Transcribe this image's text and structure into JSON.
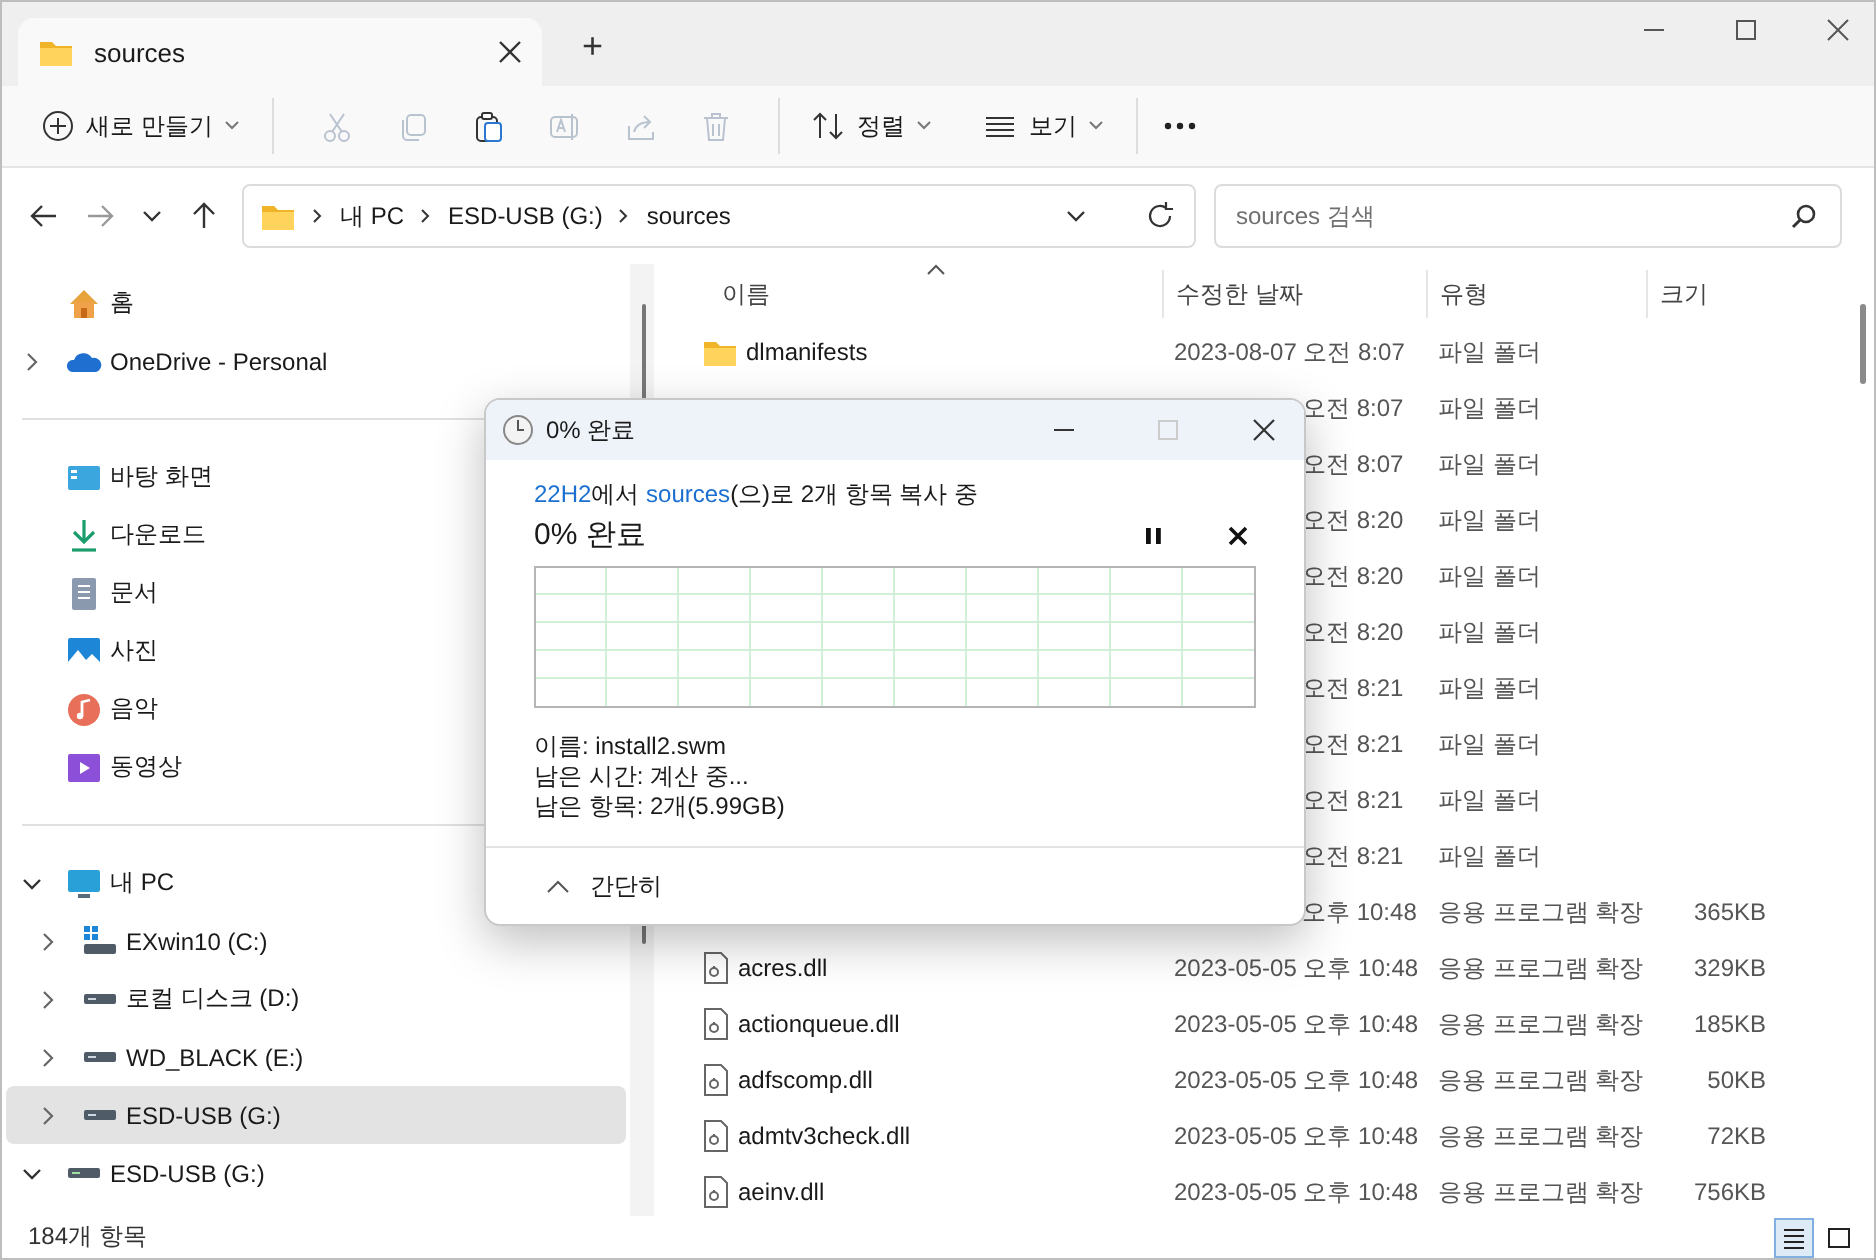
{
  "window": {
    "tab_title": "sources",
    "new_tab": "+"
  },
  "toolbar": {
    "new_label": "새로 만들기",
    "actions": [
      {
        "disabled": true
      },
      {
        "disabled": true
      },
      {
        "disabled": false
      },
      {
        "disabled": true
      },
      {
        "disabled": true
      },
      {
        "disabled": true
      }
    ],
    "sort_label": "정렬",
    "view_label": "보기"
  },
  "address": {
    "crumbs": [
      "내 PC",
      "ESD-USB (G:)",
      "sources"
    ],
    "search": {
      "placeholder": "sources 검색"
    }
  },
  "sidebar": {
    "sections": [
      [
        {
          "label": "홈",
          "selected": false
        },
        {
          "label": "OneDrive - Personal",
          "selected": false,
          "expanded": false
        }
      ],
      [
        {
          "label": "바탕 화면",
          "selected": false
        },
        {
          "label": "다운로드",
          "selected": false
        },
        {
          "label": "문서",
          "selected": false
        },
        {
          "label": "사진",
          "selected": false
        },
        {
          "label": "음악",
          "selected": false
        },
        {
          "label": "동영상",
          "selected": false
        }
      ],
      [
        {
          "label": "내 PC",
          "selected": false,
          "expanded": true,
          "children": [
            {
              "label": "EXwin10 (C:)",
              "selected": false,
              "expanded": false
            },
            {
              "label": "로컬 디스크 (D:)",
              "selected": false,
              "expanded": false
            },
            {
              "label": "WD_BLACK (E:)",
              "selected": false,
              "expanded": false
            },
            {
              "label": "ESD-USB (G:)",
              "selected": true,
              "expanded": false
            }
          ]
        },
        {
          "label": "ESD-USB (G:)",
          "selected": false,
          "expanded": true
        }
      ]
    ]
  },
  "table": {
    "columns": [
      "이름",
      "수정한 날짜",
      "유형",
      "크기"
    ],
    "rows": [
      {
        "kind": "folder",
        "name": "dlmanifests",
        "date": "2023-08-07 오전 8:07",
        "type": "파일 폴더"
      },
      {
        "kind": "covered",
        "date": "오전 8:07",
        "type": "파일 폴더"
      },
      {
        "kind": "covered",
        "date": "오전 8:07",
        "type": "파일 폴더"
      },
      {
        "kind": "covered",
        "date": "오전 8:20",
        "type": "파일 폴더"
      },
      {
        "kind": "covered",
        "date": "오전 8:20",
        "type": "파일 폴더"
      },
      {
        "kind": "covered",
        "date": "오전 8:20",
        "type": "파일 폴더"
      },
      {
        "kind": "covered",
        "date": "오전 8:21",
        "type": "파일 폴더"
      },
      {
        "kind": "covered",
        "date": "오전 8:21",
        "type": "파일 폴더"
      },
      {
        "kind": "covered",
        "date": "오전 8:21",
        "type": "파일 폴더"
      },
      {
        "kind": "covered",
        "date": "오전 8:21",
        "type": "파일 폴더"
      },
      {
        "kind": "covered",
        "date": "오후 10:48",
        "type": "응용 프로그램 확장",
        "size": "365KB"
      },
      {
        "kind": "file",
        "name": "acres.dll",
        "date": "2023-05-05 오후 10:48",
        "type": "응용 프로그램 확장",
        "size": "329KB"
      },
      {
        "kind": "file",
        "name": "actionqueue.dll",
        "date": "2023-05-05 오후 10:48",
        "type": "응용 프로그램 확장",
        "size": "185KB"
      },
      {
        "kind": "file",
        "name": "adfscomp.dll",
        "date": "2023-05-05 오후 10:48",
        "type": "응용 프로그램 확장",
        "size": "50KB"
      },
      {
        "kind": "file",
        "name": "admtv3check.dll",
        "date": "2023-05-05 오후 10:48",
        "type": "응용 프로그램 확장",
        "size": "72KB"
      },
      {
        "kind": "file",
        "name": "aeinv.dll",
        "date": "2023-05-05 오후 10:48",
        "type": "응용 프로그램 확장",
        "size": "756KB"
      }
    ]
  },
  "status_bar": {
    "count": "184개 항목",
    "views": [
      {
        "selected": true
      },
      {
        "selected": false
      }
    ]
  },
  "copy_dialog": {
    "title": "0% 완료",
    "summary": [
      {
        "text": "22H2",
        "link": true
      },
      {
        "text": "에서 ",
        "link": false
      },
      {
        "text": "sources",
        "link": true
      },
      {
        "text": "(으)로 2개 항목 복사 중",
        "link": false
      }
    ],
    "heading": "0% 완료",
    "details": [
      "이름: install2.swm",
      "남은 시간: 계산 중...",
      "남은 항목: 2개(5.99GB)"
    ],
    "less_label": "간단히"
  }
}
